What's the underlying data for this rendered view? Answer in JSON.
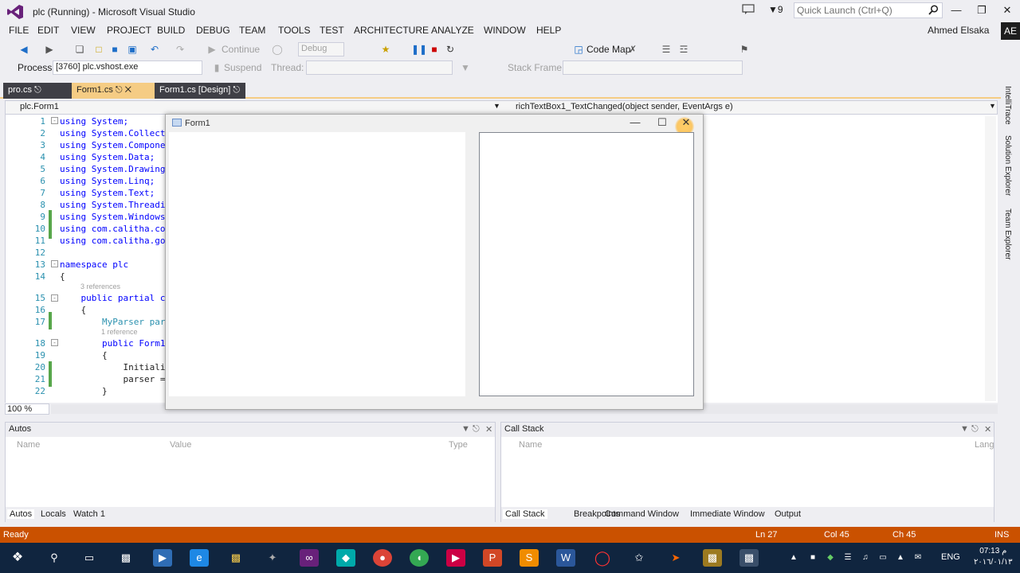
{
  "window": {
    "title": "plc (Running) - Microsoft Visual Studio",
    "notifications_count": "9",
    "quick_launch_placeholder": "Quick Launch (Ctrl+Q)",
    "user_name": "Ahmed Elsaka",
    "user_initials": "AE"
  },
  "menu": [
    "FILE",
    "EDIT",
    "VIEW",
    "PROJECT",
    "BUILD",
    "DEBUG",
    "TEAM",
    "TOOLS",
    "TEST",
    "ARCHITECTURE",
    "ANALYZE",
    "WINDOW",
    "HELP"
  ],
  "toolbar": {
    "continue_label": "Continue",
    "config_value": "Debug",
    "code_map_label": "Code Map",
    "process_label": "Process:",
    "process_value": "[3760] plc.vshost.exe",
    "suspend_label": "Suspend",
    "thread_label": "Thread:",
    "stack_frame_label": "Stack Frame:"
  },
  "tabs": [
    {
      "label": "pro.cs"
    },
    {
      "label": "Form1.cs"
    },
    {
      "label": "Form1.cs [Design]"
    }
  ],
  "nav": {
    "class_value": "plc.Form1",
    "member_value": "richTextBox1_TextChanged(object sender, EventArgs e)"
  },
  "code": {
    "lines": [
      {
        "n": "1",
        "t": "using System;"
      },
      {
        "n": "2",
        "t": "using System.Collect"
      },
      {
        "n": "3",
        "t": "using System.Compone"
      },
      {
        "n": "4",
        "t": "using System.Data;"
      },
      {
        "n": "5",
        "t": "using System.Drawing"
      },
      {
        "n": "6",
        "t": "using System.Linq;"
      },
      {
        "n": "7",
        "t": "using System.Text;"
      },
      {
        "n": "8",
        "t": "using System.Threadi"
      },
      {
        "n": "9",
        "t": "using System.Windows"
      },
      {
        "n": "10",
        "t": "using com.calitha.co"
      },
      {
        "n": "11",
        "t": "using com.calitha.go"
      },
      {
        "n": "12",
        "t": ""
      },
      {
        "n": "13",
        "t": "namespace plc"
      },
      {
        "n": "14",
        "t": "{"
      },
      {
        "n": "15",
        "t": "    public partial c"
      },
      {
        "n": "16",
        "t": "    {"
      },
      {
        "n": "17",
        "t": "        MyParser par"
      },
      {
        "n": "18",
        "t": "        public Form1"
      },
      {
        "n": "19",
        "t": "        {"
      },
      {
        "n": "20",
        "t": "            Initiali"
      },
      {
        "n": "21",
        "t": "            parser ="
      },
      {
        "n": "22",
        "t": "        }"
      }
    ],
    "refs_3": "3 references",
    "refs_1": "1 reference",
    "zoom": "100 %"
  },
  "form": {
    "title": "Form1"
  },
  "autos": {
    "title": "Autos",
    "columns": [
      "Name",
      "Value",
      "Type"
    ],
    "tabs": [
      "Autos",
      "Locals",
      "Watch 1"
    ]
  },
  "callstack": {
    "title": "Call Stack",
    "columns": [
      "Name",
      "Lang"
    ],
    "tabs": [
      "Call Stack",
      "Breakpoints",
      "Command Window",
      "Immediate Window",
      "Output"
    ]
  },
  "side_tabs": [
    "IntelliTrace",
    "Solution Explorer",
    "Team Explorer"
  ],
  "status": {
    "state": "Ready",
    "ln": "Ln 27",
    "col": "Col 45",
    "ch": "Ch 45",
    "mode": "INS"
  },
  "tray": {
    "lang": "ENG",
    "time": "07:13 م",
    "date": "٢٠١٦/٠١/١٣"
  },
  "colors": {
    "accent": "#ca5100",
    "tab_active": "#f5cc84",
    "taskbar": "#10253f"
  }
}
